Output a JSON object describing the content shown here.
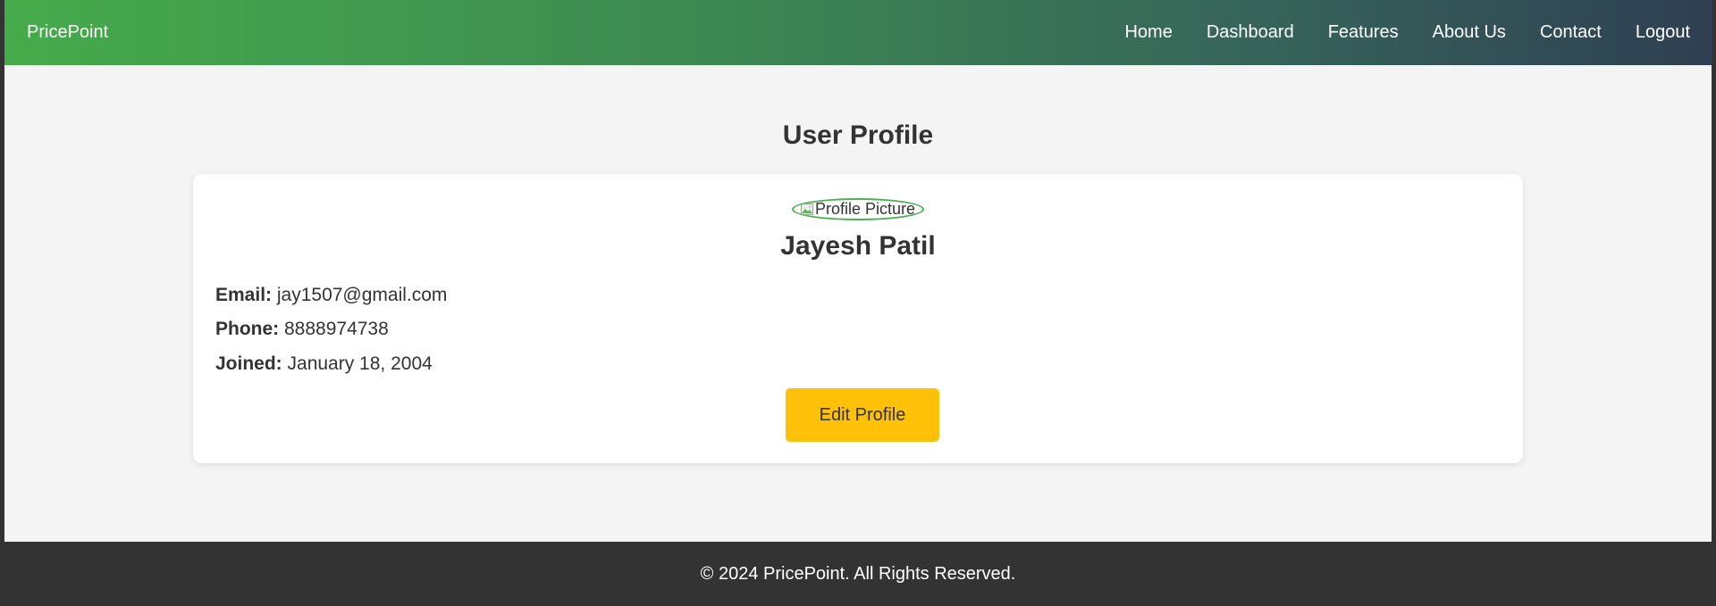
{
  "nav": {
    "brand": "PricePoint",
    "links": [
      "Home",
      "Dashboard",
      "Features",
      "About Us",
      "Contact",
      "Logout"
    ]
  },
  "page": {
    "title": "User Profile"
  },
  "profile": {
    "avatar_alt": "Profile Picture",
    "name": "Jayesh Patil",
    "email_label": "Email:",
    "email": "jay1507@gmail.com",
    "phone_label": "Phone:",
    "phone": "8888974738",
    "joined_label": "Joined:",
    "joined": "January 18, 2004",
    "edit_button": "Edit Profile"
  },
  "footer": {
    "text": "© 2024 PricePoint. All Rights Reserved."
  },
  "colors": {
    "nav_gradient_start": "#46ab4b",
    "nav_gradient_end": "#2f3f52",
    "button": "#ffc107",
    "avatar_border": "#4caf50",
    "footer_bg": "#333333"
  }
}
